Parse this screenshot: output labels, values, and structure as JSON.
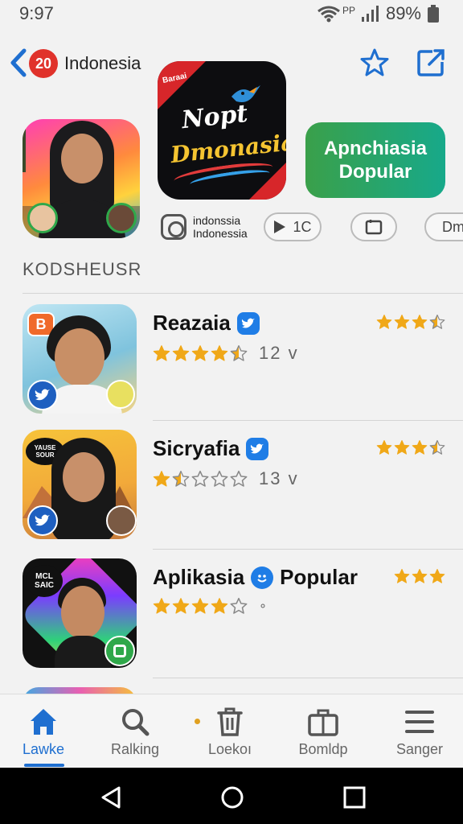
{
  "status_bar": {
    "time": "9:97",
    "network": "PP",
    "battery": "89%"
  },
  "header": {
    "badge_count": "20",
    "region": "Indonesia"
  },
  "featured": {
    "app_tag": "Baraai",
    "app_title_line1": "Nopt",
    "app_title_line2": "Dmonasia",
    "popular_line1": "Apnchiasia",
    "popular_line2": "Dopular",
    "instagram_line1": "indonssia",
    "instagram_line2": "Indonessia",
    "chip_play_label": "1C",
    "chip_partial_label": "Dm"
  },
  "section": {
    "heading": "KODSHEUSR"
  },
  "apps": [
    {
      "name": "Reazaia",
      "rating": 4.5,
      "count": "12 v",
      "thumb_tag": "B",
      "right_rating": 3.5
    },
    {
      "name": "Sicryafia",
      "rating": 1.5,
      "count": "13 v",
      "thumb_tag": "YAUSE SOUR",
      "right_rating": 3.5
    },
    {
      "name": "Aplikasia",
      "name_suffix": "Popular",
      "rating": 4,
      "count": "∘",
      "thumb_tag": "MCL SAIC",
      "right_rating": 3
    }
  ],
  "bottom_nav": [
    {
      "label": "Lawke",
      "icon": "home-icon",
      "active": true
    },
    {
      "label": "Ralking",
      "icon": "search-icon",
      "active": false
    },
    {
      "label": "Loekoı",
      "icon": "trash-icon",
      "active": false
    },
    {
      "label": "Bomldp",
      "icon": "briefcase-icon",
      "active": false
    },
    {
      "label": "Sanger",
      "icon": "menu-icon",
      "active": false
    }
  ],
  "colors": {
    "accent": "#1f6fd0",
    "star": "#f0a818",
    "badge": "#e0322b",
    "popular_from": "#3aa04a",
    "popular_to": "#17a98a"
  }
}
